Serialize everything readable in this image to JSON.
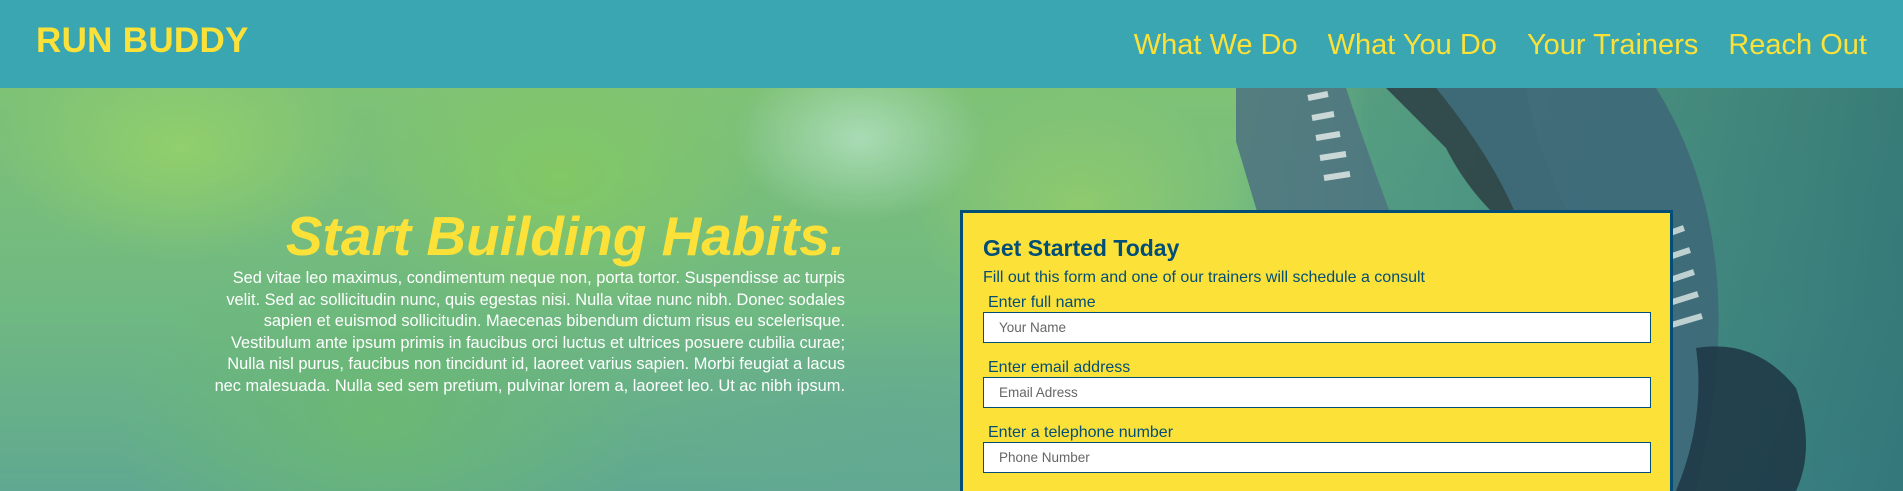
{
  "header": {
    "logo": "RUN BUDDY",
    "nav": [
      {
        "label": "What We Do"
      },
      {
        "label": "What You Do"
      },
      {
        "label": "Your Trainers"
      },
      {
        "label": "Reach Out"
      }
    ]
  },
  "hero": {
    "title": "Start Building Habits.",
    "body": "Sed vitae leo maximus, condimentum neque non, porta tortor. Suspendisse ac turpis velit. Sed ac sollicitudin nunc, quis egestas nisi. Nulla vitae nunc nibh. Donec sodales sapien et euismod sollicitudin. Maecenas bibendum dictum risus eu scelerisque. Vestibulum ante ipsum primis in faucibus orci luctus et ultrices posuere cubilia curae; Nulla nisl purus, faucibus non tincidunt id, laoreet varius sapien. Morbi feugiat a lacus nec malesuada. Nulla sed sem pretium, pulvinar lorem a, laoreet leo. Ut ac nibh ipsum."
  },
  "form": {
    "title": "Get Started Today",
    "subtitle": "Fill out this form and one of our trainers will schedule a consult",
    "fields": [
      {
        "label": "Enter full name",
        "placeholder": "Your Name",
        "value": ""
      },
      {
        "label": "Enter email address",
        "placeholder": "Email Adress",
        "value": ""
      },
      {
        "label": "Enter a telephone number",
        "placeholder": "Phone Number",
        "value": ""
      }
    ]
  },
  "colors": {
    "header_bg": "#39a6b2",
    "accent_yellow": "#fce138",
    "form_border": "#024e76"
  }
}
